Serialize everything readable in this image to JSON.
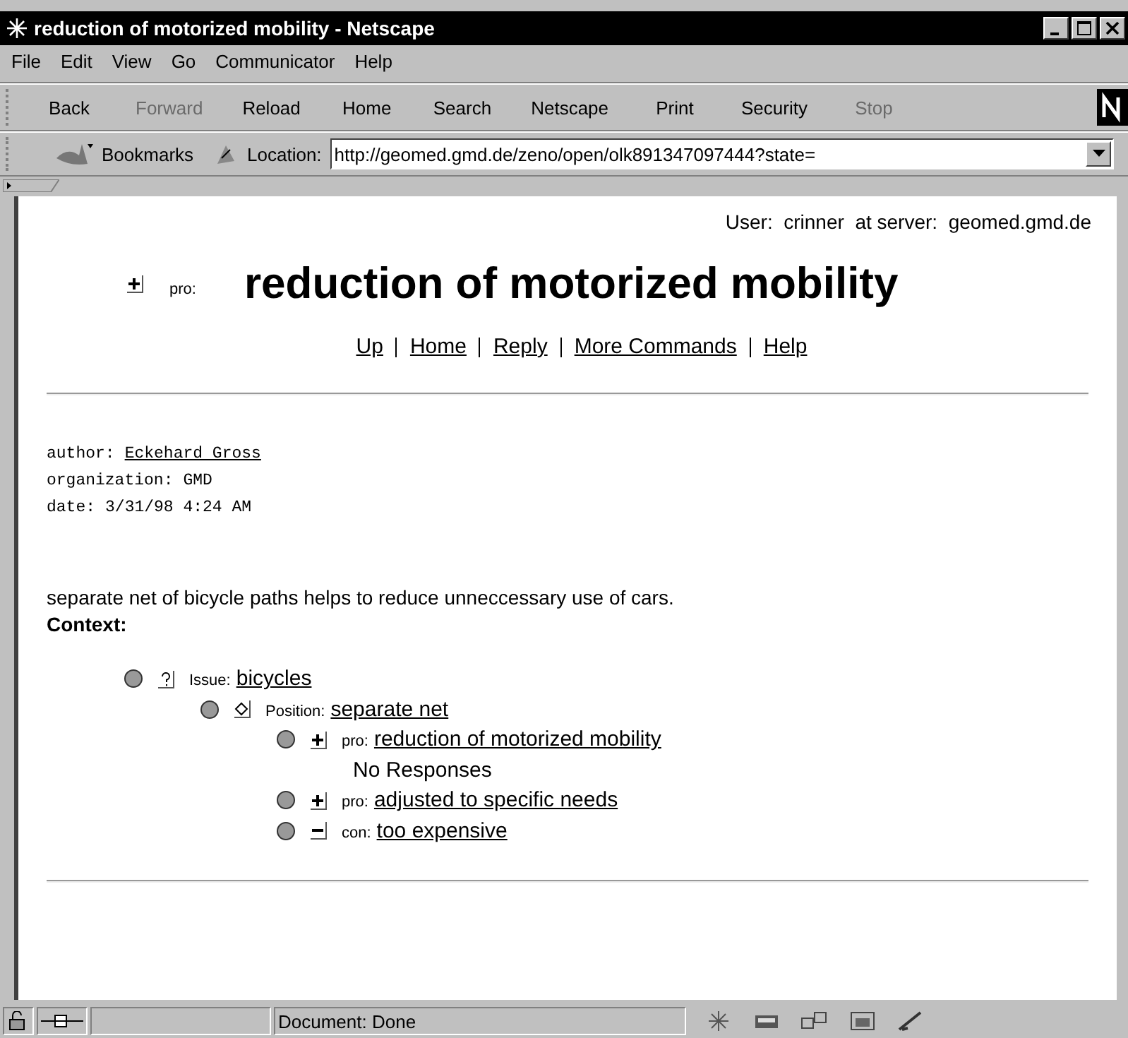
{
  "window": {
    "title": "reduction of motorized mobility - Netscape"
  },
  "menu": [
    "File",
    "Edit",
    "View",
    "Go",
    "Communicator",
    "Help"
  ],
  "toolbar": [
    {
      "label": "Back",
      "disabled": false
    },
    {
      "label": "Forward",
      "disabled": true
    },
    {
      "label": "Reload",
      "disabled": false
    },
    {
      "label": "Home",
      "disabled": false
    },
    {
      "label": "Search",
      "disabled": false
    },
    {
      "label": "Netscape",
      "disabled": false
    },
    {
      "label": "Print",
      "disabled": false
    },
    {
      "label": "Security",
      "disabled": false
    },
    {
      "label": "Stop",
      "disabled": true
    }
  ],
  "location_bar": {
    "bookmarks": "Bookmarks",
    "label": "Location:",
    "value": "http://geomed.gmd.de/zeno/open/olk891347097444?state="
  },
  "page": {
    "user_line": {
      "user_label": "User:",
      "user": "crinner",
      "server_label": "at server:",
      "server": "geomed.gmd.de"
    },
    "heading": {
      "kind": "pro",
      "prefix": "pro:",
      "title": "reduction of motorized mobility"
    },
    "nav_links": [
      "Up",
      "Home",
      "Reply",
      "More Commands",
      "Help"
    ],
    "meta": [
      {
        "label": "author:",
        "value": "Eckehard Gross",
        "link": true
      },
      {
        "label": "organization:",
        "value": "GMD",
        "link": false
      },
      {
        "label": "date:",
        "value": "3/31/98 4:24 AM",
        "link": false
      }
    ],
    "body": "separate net of bicycle paths helps to reduce unneccessary use of cars.",
    "context_label": "Context:",
    "context": [
      {
        "kind": "issue",
        "prefix": "Issue:",
        "title": "bicycles",
        "children": [
          {
            "kind": "position",
            "prefix": "Position:",
            "title": "separate net",
            "children": [
              {
                "kind": "pro",
                "prefix": "pro:",
                "title": "reduction of motorized mobility",
                "note": "No Responses"
              },
              {
                "kind": "pro",
                "prefix": "pro:",
                "title": "adjusted to specific needs"
              },
              {
                "kind": "con",
                "prefix": "con:",
                "title": "too expensive"
              }
            ]
          }
        ]
      }
    ]
  },
  "status_bar": {
    "text": "Document: Done"
  }
}
